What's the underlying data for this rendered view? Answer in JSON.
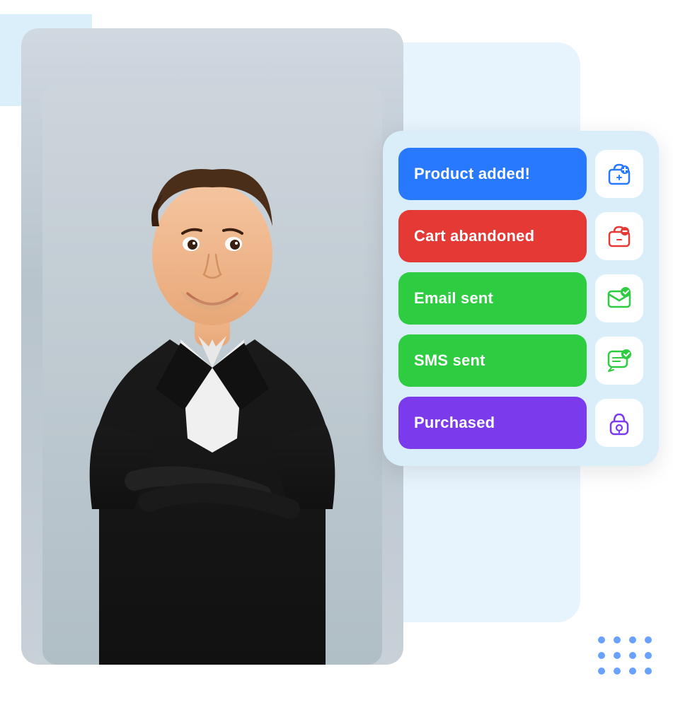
{
  "scene": {
    "bg_color": "#e8f4fd",
    "card": {
      "events": [
        {
          "id": "product-added",
          "label": "Product added!",
          "color_class": "blue",
          "color": "#2979ff",
          "icon_name": "shop-icon",
          "icon_unicode": "🏪"
        },
        {
          "id": "cart-abandoned",
          "label": "Cart abandoned",
          "color_class": "red",
          "color": "#e53935",
          "icon_name": "shop-red-icon",
          "icon_unicode": "🏪"
        },
        {
          "id": "email-sent",
          "label": "Email sent",
          "color_class": "green",
          "color": "#2ecc40",
          "icon_name": "email-icon",
          "icon_unicode": "✉"
        },
        {
          "id": "sms-sent",
          "label": "SMS sent",
          "color_class": "green2",
          "color": "#2ecc40",
          "icon_name": "sms-icon",
          "icon_unicode": "💬"
        },
        {
          "id": "purchased",
          "label": "Purchased",
          "color_class": "purple",
          "color": "#7c3aed",
          "icon_name": "lock-icon",
          "icon_unicode": "🔒"
        }
      ]
    },
    "dots": {
      "count": 12,
      "color": "#2979ff"
    }
  }
}
